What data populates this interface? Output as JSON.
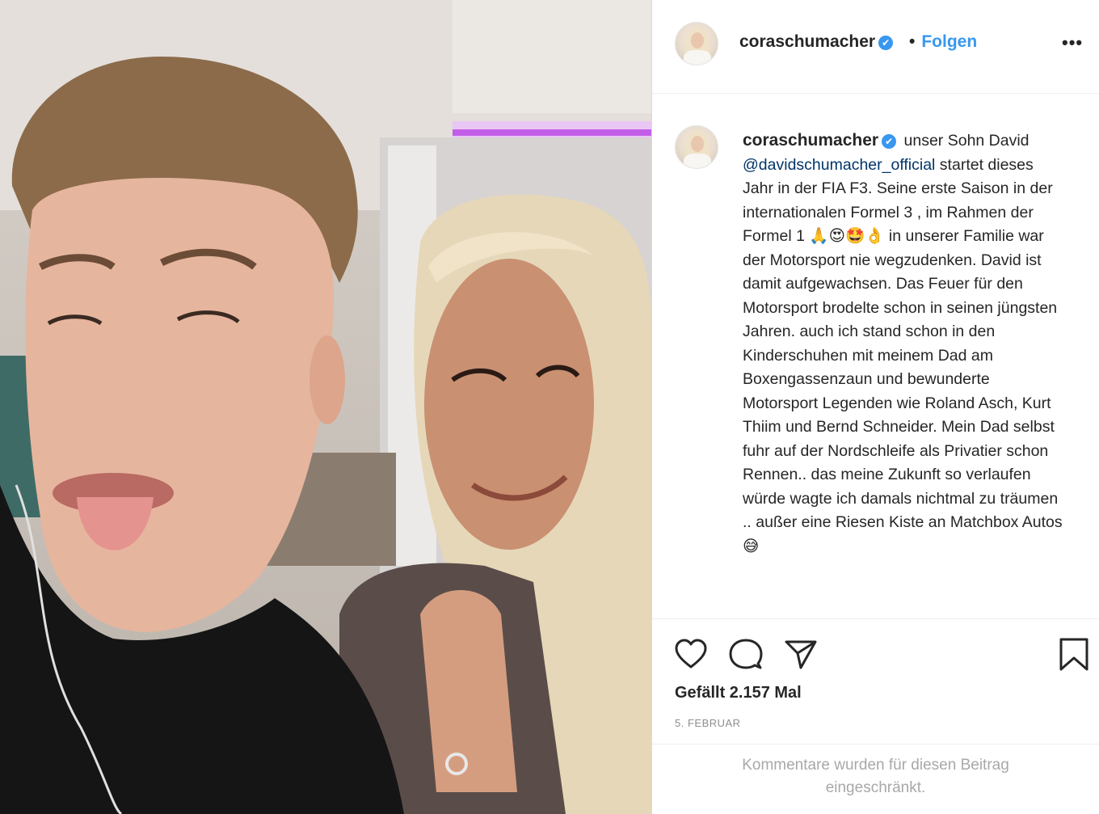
{
  "post": {
    "username": "coraschumacher",
    "verified_mark": "✔",
    "separator": "•",
    "follow_label": "Folgen",
    "more_label": "•••",
    "caption": {
      "username": "coraschumacher",
      "text_before_mention": "unser Sohn David",
      "mention": "@davidschumacher_official",
      "text_after_mention": " startet dieses Jahr in der FIA F3. Seine erste Saison in der internationalen Formel 3 , im Rahmen der Formel 1 🙏😍🤩👌 in unserer Familie war der Motorsport nie wegzudenken. David ist damit aufgewachsen. Das Feuer für den Motorsport brodelte schon in seinen jüngsten Jahren. auch ich stand schon in den Kinderschuhen mit meinem Dad am Boxengassenzaun und bewunderte Motorsport Legenden wie Roland Asch, Kurt Thiim und Bernd Schneider. Mein Dad selbst fuhr auf der Nordschleife als Privatier schon Rennen.. das meine Zukunft so verlaufen würde wagte ich damals nichtmal zu träumen .. außer eine Riesen Kiste an Matchbox Autos 😅"
    },
    "likes": "Gefällt 2.157 Mal",
    "date": "5. FEBRUAR",
    "comments_restricted": "Kommentare wurden für diesen Beitrag eingeschränkt.",
    "icons": {
      "like": "heart-icon",
      "comment": "comment-icon",
      "share": "share-icon",
      "save": "bookmark-icon"
    },
    "colors": {
      "link": "#3897f0",
      "mention": "#003569",
      "text": "#262626",
      "muted": "#8e8e8e"
    }
  }
}
